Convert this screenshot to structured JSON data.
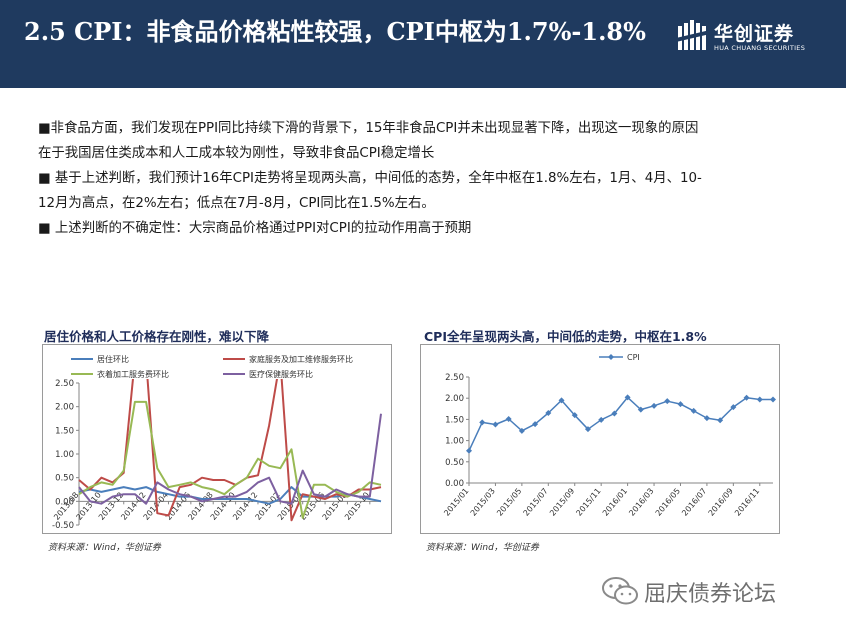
{
  "header": {
    "title": "2.5 CPI：非食品价格粘性较强，CPI中枢为1.7%-1.8%",
    "logo_cn": "华创证券",
    "logo_en": "HUA CHUANG SECURITIES"
  },
  "bullets": [
    "■非食品方面，我们发现在PPI同比持续下滑的背景下，15年非食品CPI并未出现显著下降，出现这一现象的原因",
    "在于我国居住类成本和人工成本较为刚性，导致非食品CPI稳定增长",
    "■ 基于上述判断，我们预计16年CPI走势将呈现两头高，中间低的态势，全年中枢在1.8%左右，1月、4月、10-",
    "12月为高点，在2%左右；低点在7月-8月，CPI同比在1.5%左右。",
    "■ 上述判断的不确定性：大宗商品价格通过PPI对CPI的拉动作用高于预期"
  ],
  "left_chart": {
    "title": "居住价格和人工价格存在刚性，难以下降",
    "source": "资料来源：Wind，华创证券"
  },
  "right_chart": {
    "title": "CPI全年呈现两头高，中间低的走势，中枢在1.8%",
    "source": "资料来源：Wind，华创证券"
  },
  "watermark": {
    "text": "屈庆债券论坛"
  },
  "colors": {
    "header_bg": "#1f3a5f",
    "series_housing": "#4a7ebb",
    "series_household": "#be4b48",
    "series_clothing": "#98b954",
    "series_medical": "#7d60a0",
    "cpi_line": "#4a7ebb"
  },
  "chart_data": [
    {
      "type": "line",
      "title": "",
      "xlabel": "",
      "ylabel": "",
      "ylim": [
        -0.5,
        2.5
      ],
      "yticks": [
        "-0.50",
        "0.00",
        "0.50",
        "1.00",
        "1.50",
        "2.00",
        "2.50"
      ],
      "ytick_values": [
        -0.5,
        0,
        0.5,
        1,
        1.5,
        2,
        2.5
      ],
      "x": [
        "2013-08",
        "2013-09",
        "2013-10",
        "2013-11",
        "2013-12",
        "2014-01",
        "2014-02",
        "2014-03",
        "2014-04",
        "2014-05",
        "2014-06",
        "2014-07",
        "2014-08",
        "2014-09",
        "2014-10",
        "2014-11",
        "2014-12",
        "2015-01",
        "2015-02",
        "2015-03",
        "2015-04",
        "2015-05",
        "2015-06",
        "2015-07",
        "2015-08",
        "2015-09",
        "2015-10",
        "2015-11"
      ],
      "xtick_labels": [
        "2013-08",
        "2013-10",
        "2013-12",
        "2014-02",
        "2014-04",
        "2014-06",
        "2014-08",
        "2014-10",
        "2014-12",
        "2015-02",
        "2015-04",
        "2015-06",
        "2015-08",
        "2015-10"
      ],
      "legend": "top",
      "grid": false,
      "series": [
        {
          "name": "居住环比",
          "color": "#4a7ebb",
          "values": [
            0.2,
            0.25,
            0.2,
            0.25,
            0.3,
            0.25,
            0.3,
            0.2,
            0.15,
            0.1,
            0.1,
            0.05,
            0.05,
            0.05,
            0.05,
            0.05,
            0.0,
            -0.05,
            0.05,
            0.3,
            0.1,
            0.1,
            0.1,
            0.1,
            0.15,
            0.1,
            0.05,
            0.0
          ]
        },
        {
          "name": "家庭服务及加工维修服务环比",
          "color": "#be4b48",
          "values": [
            0.45,
            0.25,
            0.5,
            0.4,
            0.6,
            5.0,
            5.0,
            -0.25,
            -0.3,
            0.3,
            0.35,
            0.5,
            0.45,
            0.45,
            0.35,
            0.5,
            0.55,
            1.6,
            5.0,
            -0.4,
            0.15,
            0.1,
            0.05,
            0.15,
            0.1,
            0.25,
            0.25,
            0.3
          ]
        },
        {
          "name": "衣着加工服务费环比",
          "color": "#98b954",
          "values": [
            0.15,
            0.3,
            0.4,
            0.35,
            0.65,
            2.1,
            2.1,
            0.7,
            0.3,
            0.35,
            0.4,
            0.3,
            0.25,
            0.15,
            0.35,
            0.5,
            0.9,
            0.75,
            0.7,
            1.1,
            -0.35,
            0.35,
            0.35,
            0.2,
            0.1,
            0.2,
            0.4,
            0.35
          ]
        },
        {
          "name": "医疗保健服务环比",
          "color": "#7d60a0",
          "values": [
            0.3,
            0.0,
            -0.05,
            0.1,
            0.15,
            0.15,
            -0.05,
            0.4,
            0.25,
            0.15,
            0.1,
            0.0,
            0.05,
            0.1,
            0.1,
            0.2,
            0.4,
            0.5,
            0.0,
            -0.05,
            0.65,
            0.15,
            0.1,
            0.25,
            0.15,
            0.1,
            0.1,
            1.85
          ]
        }
      ]
    },
    {
      "type": "line",
      "title": "",
      "xlabel": "",
      "ylabel": "",
      "ylim": [
        0,
        2.5
      ],
      "yticks": [
        "0.00",
        "0.50",
        "1.00",
        "1.50",
        "2.00",
        "2.50"
      ],
      "ytick_values": [
        0,
        0.5,
        1,
        1.5,
        2,
        2.5
      ],
      "x": [
        "2015/01",
        "2015/02",
        "2015/03",
        "2015/04",
        "2015/05",
        "2015/06",
        "2015/07",
        "2015/08",
        "2015/09",
        "2015/10",
        "2015/11",
        "2015/12",
        "2016/01",
        "2016/02",
        "2016/03",
        "2016/04",
        "2016/05",
        "2016/06",
        "2016/07",
        "2016/08",
        "2016/09",
        "2016/10",
        "2016/11",
        "2016/12"
      ],
      "xtick_labels": [
        "2015/01",
        "2015/03",
        "2015/05",
        "2015/07",
        "2015/09",
        "2015/11",
        "2016/01",
        "2016/03",
        "2016/05",
        "2016/07",
        "2016/09",
        "2016/11"
      ],
      "legend": "top-left",
      "grid": false,
      "series": [
        {
          "name": "CPI",
          "color": "#4a7ebb",
          "values": [
            0.76,
            1.43,
            1.38,
            1.51,
            1.23,
            1.39,
            1.65,
            1.95,
            1.6,
            1.27,
            1.49,
            1.64,
            2.02,
            1.73,
            1.82,
            1.93,
            1.86,
            1.7,
            1.53,
            1.48,
            1.79,
            2.01,
            1.97,
            1.97
          ]
        }
      ]
    }
  ]
}
